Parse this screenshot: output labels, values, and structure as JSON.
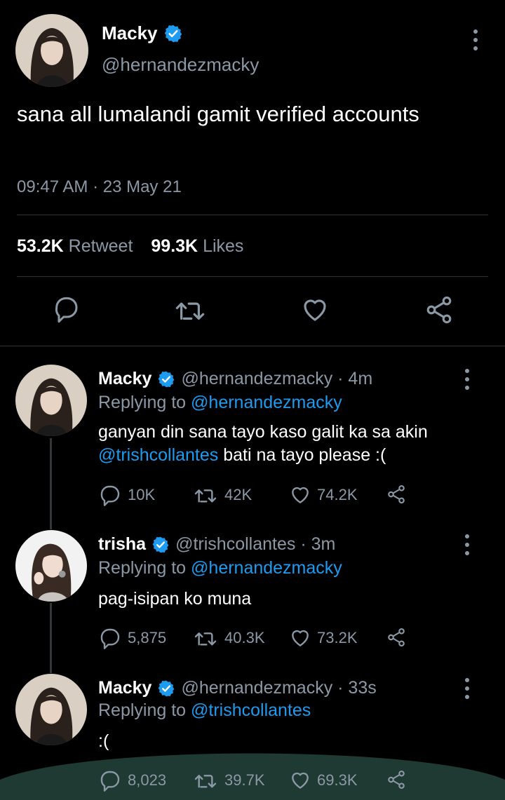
{
  "main_tweet": {
    "name": "Macky",
    "handle": "@hernandezmacky",
    "text": "sana all lumalandi gamit verified accounts",
    "timestamp": "09:47 AM · 23 May 21",
    "retweets_count": "53.2K",
    "retweets_label": "Retweet",
    "likes_count": "99.3K",
    "likes_label": "Likes",
    "actions": [
      "reply-icon",
      "retweet-icon",
      "like-icon",
      "share-icon"
    ]
  },
  "replies": [
    {
      "name": "Macky",
      "handle": "@hernandezmacky · 4m",
      "replying_prefix": "Replying to",
      "replying_to": "@hernandezmacky",
      "text_mention": "",
      "text_before": "ganyan din sana tayo kaso galit ka sa akin",
      "text_link": "@trishcollantes",
      "text_after": " bati na tayo please :(",
      "replies": "10K",
      "retweets": "42K",
      "likes": "74.2K"
    },
    {
      "name": "trisha",
      "handle": "@trishcollantes · 3m",
      "replying_prefix": "Replying to",
      "replying_to": "@hernandezmacky",
      "text_before": "pag-isipan ko muna",
      "replies": "5,875",
      "retweets": "40.3K",
      "likes": "73.2K"
    },
    {
      "name": "Macky",
      "handle": "@hernandezmacky · 33s",
      "replying_prefix": "Replying to",
      "replying_to": "@trishcollantes",
      "text_before": ":(",
      "replies": "8,023",
      "retweets": "39.7K",
      "likes": "69.3K"
    }
  ],
  "colors": {
    "background": "#000000",
    "link": "#1d9bf0",
    "muted": "#8b98a5",
    "verified": "#1d9bf0",
    "bottom_sheet": "#1e3a32"
  }
}
